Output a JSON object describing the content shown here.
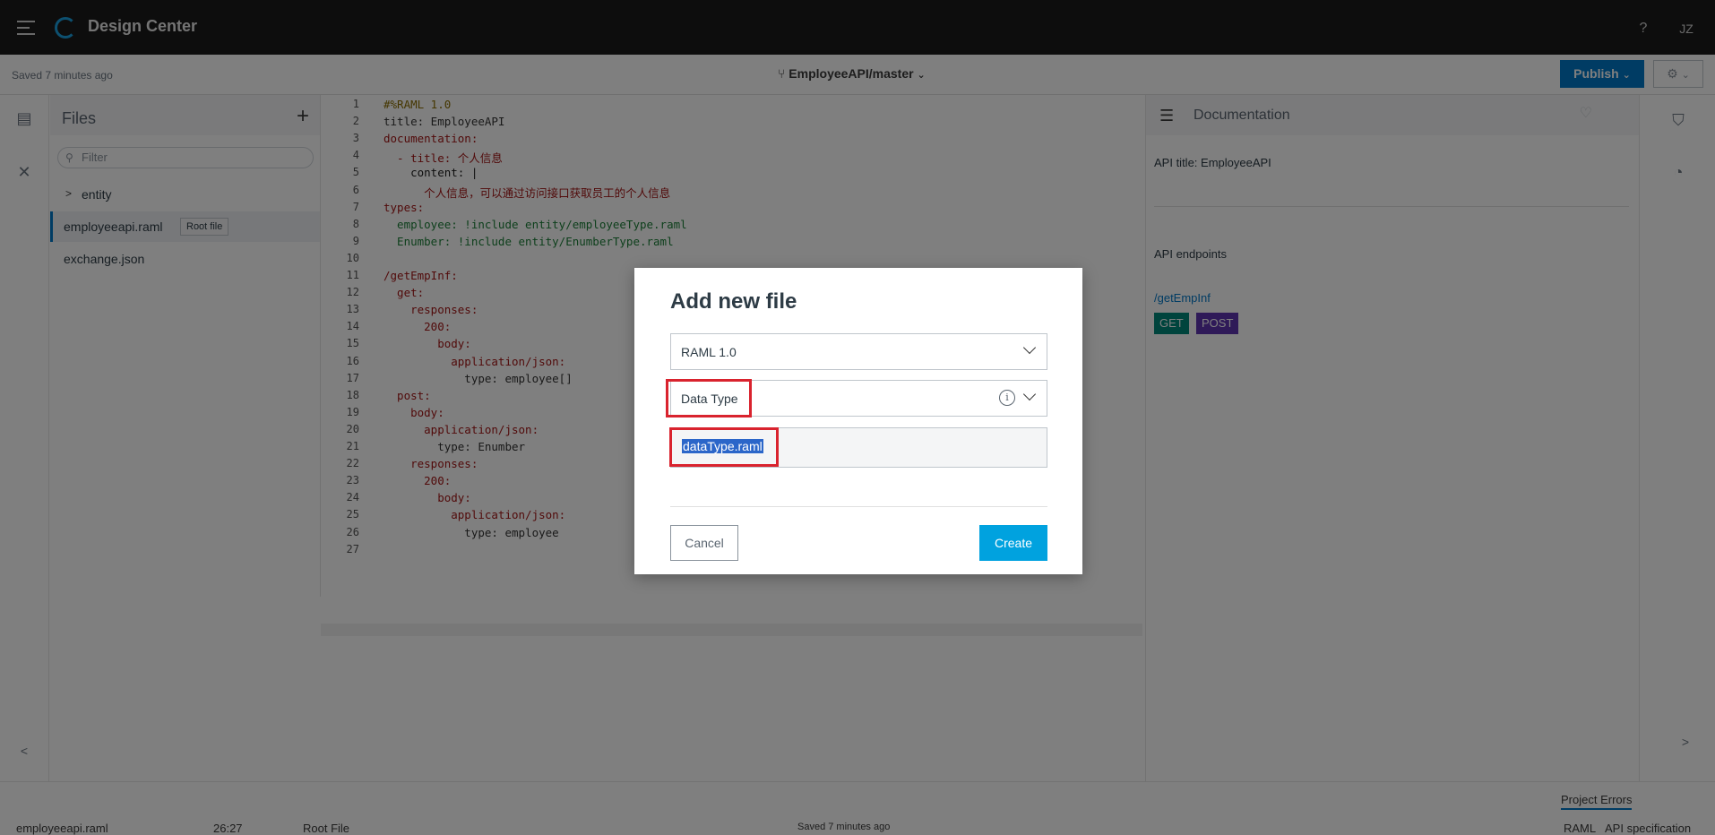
{
  "topbar": {
    "app_title": "Design Center",
    "help": "?",
    "user_initials": "JZ"
  },
  "subbar": {
    "saved": "Saved 7 minutes ago",
    "branch": "EmployeeAPI/master",
    "publish": "Publish"
  },
  "files": {
    "title": "Files",
    "filter_placeholder": "Filter",
    "items": [
      {
        "label": "entity",
        "type": "folder"
      },
      {
        "label": "employeeapi.raml",
        "badge": "Root file"
      },
      {
        "label": "exchange.json"
      }
    ]
  },
  "editor": {
    "line_numbers": [
      "1",
      "2",
      "3",
      "4",
      "5",
      "6",
      "7",
      "8",
      "9",
      "10",
      "11",
      "12",
      "13",
      "14",
      "15",
      "16",
      "17",
      "18",
      "19",
      "20",
      "21",
      "22",
      "23",
      "24",
      "25",
      "26",
      "27"
    ],
    "lines": [
      "#%RAML 1.0",
      "title: EmployeeAPI",
      "documentation:",
      "  - title: 个人信息",
      "    content: |",
      "      个人信息，可以通过访问接口获取员工的个人信息",
      "types:",
      "  employee: !include entity/employeeType.raml",
      "  Enumber: !include entity/EnumberType.raml",
      "",
      "/getEmpInf:",
      "  get:",
      "    responses:",
      "      200:",
      "        body:",
      "          application/json:",
      "            type: employee[]",
      "  post:",
      "    body:",
      "      application/json:",
      "        type: Enumber",
      "    responses:",
      "      200:",
      "        body:",
      "          application/json:",
      "            type: employee",
      ""
    ]
  },
  "docs": {
    "title": "Documentation",
    "api_title": "API title: EmployeeAPI",
    "endpoints_label": "API endpoints",
    "endpoint": "/getEmpInf",
    "methods": [
      {
        "label": "GET",
        "color": "#00897b"
      },
      {
        "label": "POST",
        "color": "#5e35b1"
      }
    ]
  },
  "statusbar": {
    "file": "employeeapi.raml",
    "position": "26:27",
    "file_role": "Root File",
    "saved": "Saved 7 minutes ago",
    "project_errors": "Project Errors",
    "lang": "RAML",
    "spec": "API specification"
  },
  "modal": {
    "title": "Add new file",
    "version": "RAML 1.0",
    "file_type": "Data Type",
    "info": "i",
    "filename": "dataType.raml",
    "cancel": "Cancel",
    "create": "Create"
  },
  "colors": {
    "accent": "#0078c8",
    "create": "#00a2df",
    "highlight": "#d9232e"
  }
}
